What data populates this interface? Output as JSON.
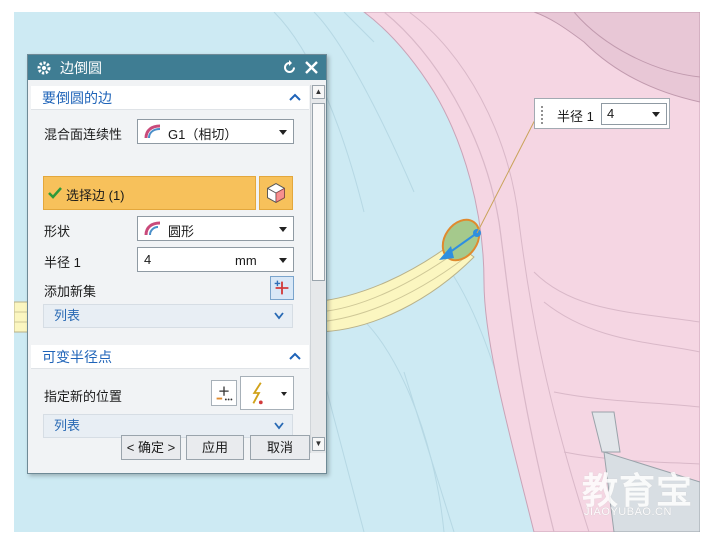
{
  "dialog": {
    "title": "边倒圆",
    "section1": {
      "title": "要倒圆的边",
      "continuity_label": "混合面连续性",
      "continuity_value": "G1（相切）",
      "select_edge_label": "选择边 (1)",
      "shape_label": "形状",
      "shape_value": "圆形",
      "radius_label": "半径 1",
      "radius_value": "4",
      "radius_unit": "mm",
      "add_new_set_label": "添加新集",
      "list_label": "列表"
    },
    "section2": {
      "title": "可变半径点",
      "specify_location_label": "指定新的位置",
      "list_label": "列表"
    },
    "buttons": {
      "ok": "< 确定 >",
      "apply": "应用",
      "cancel": "取消"
    }
  },
  "radius_tag": {
    "label": "半径 1",
    "value": "4"
  },
  "watermark": {
    "cn": "教育宝",
    "en": "JIAOYUBAO.CN"
  },
  "colors": {
    "titlebar": "#3f7d93",
    "section_title": "#1e63b8",
    "selection_highlight": "#f7c15b",
    "viewport_blue": "#cdeaf3",
    "part_pink": "#f5d6e3",
    "tube_yellow": "#fbf6c0"
  }
}
